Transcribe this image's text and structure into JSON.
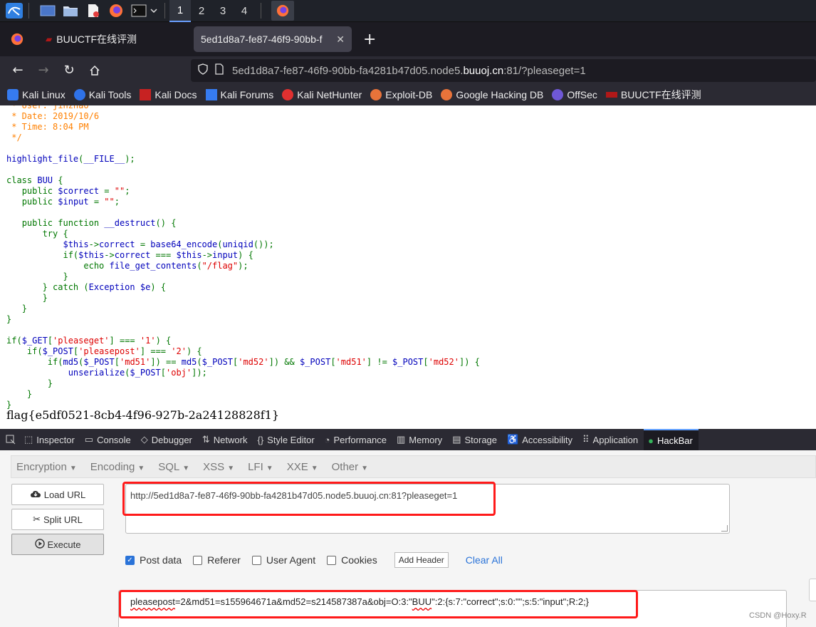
{
  "taskbar": {
    "workspaces": [
      "1",
      "2",
      "3",
      "4"
    ],
    "active_workspace": "1"
  },
  "tabs": [
    {
      "label": "BUUCTF在线评测",
      "active": false
    },
    {
      "label": "5ed1d8a7-fe87-46f9-90bb-f",
      "active": true
    }
  ],
  "navbar": {
    "url_prefix": "5ed1d8a7-fe87-46f9-90bb-fa4281b47d05.node5.",
    "url_host": "buuoj.cn",
    "url_suffix": ":81/?pleaseget=1"
  },
  "bookmarks": [
    {
      "label": "Kali Linux",
      "color": "#367bf0"
    },
    {
      "label": "Kali Tools",
      "color": "#2f72e8"
    },
    {
      "label": "Kali Docs",
      "color": "#c72222"
    },
    {
      "label": "Kali Forums",
      "color": "#367bf0"
    },
    {
      "label": "Kali NetHunter",
      "color": "#e03030"
    },
    {
      "label": "Exploit-DB",
      "color": "#e8733a"
    },
    {
      "label": "Google Hacking DB",
      "color": "#e8733a"
    },
    {
      "label": "OffSec",
      "color": "#6f58d6"
    },
    {
      "label": "BUUCTF在线评测",
      "color": "#b01818"
    }
  ],
  "page": {
    "flag": "flag{e5df0521-8cb4-4f96-927b-2a24128828f1}"
  },
  "devtools": {
    "tabs": [
      {
        "label": "Inspector",
        "icon": "⬚"
      },
      {
        "label": "Console",
        "icon": "▭"
      },
      {
        "label": "Debugger",
        "icon": "◇"
      },
      {
        "label": "Network",
        "icon": "⇅"
      },
      {
        "label": "Style Editor",
        "icon": "{}"
      },
      {
        "label": "Performance",
        "icon": "◔"
      },
      {
        "label": "Memory",
        "icon": "▥"
      },
      {
        "label": "Storage",
        "icon": "▤"
      },
      {
        "label": "Accessibility",
        "icon": "♿"
      },
      {
        "label": "Application",
        "icon": "⠿"
      },
      {
        "label": "HackBar",
        "icon": "●"
      }
    ]
  },
  "hackbar": {
    "menu": [
      "Encryption",
      "Encoding",
      "SQL",
      "XSS",
      "LFI",
      "XXE",
      "Other"
    ],
    "buttons": {
      "load_url": "Load URL",
      "split_url": "Split URL",
      "execute": "Execute"
    },
    "url_value": "http://5ed1d8a7-fe87-46f9-90bb-fa4281b47d05.node5.buuoj.cn:81?pleaseget=1",
    "options": {
      "post_data": "Post data",
      "referer": "Referer",
      "user_agent": "User Agent",
      "cookies": "Cookies",
      "add_header": "Add Header",
      "clear_all": "Clear All"
    },
    "post_value_a": "pleasepost",
    "post_value_b": "=2&md51=s155964671a&md52=s214587387a&obj=O:3:\"",
    "post_value_c": "BUU",
    "post_value_d": "\":2:{s:7:\"correct\";s:0:\"\";s:5:\"input\";R:2;}"
  },
  "watermark": "CSDN @Hoxy.R"
}
